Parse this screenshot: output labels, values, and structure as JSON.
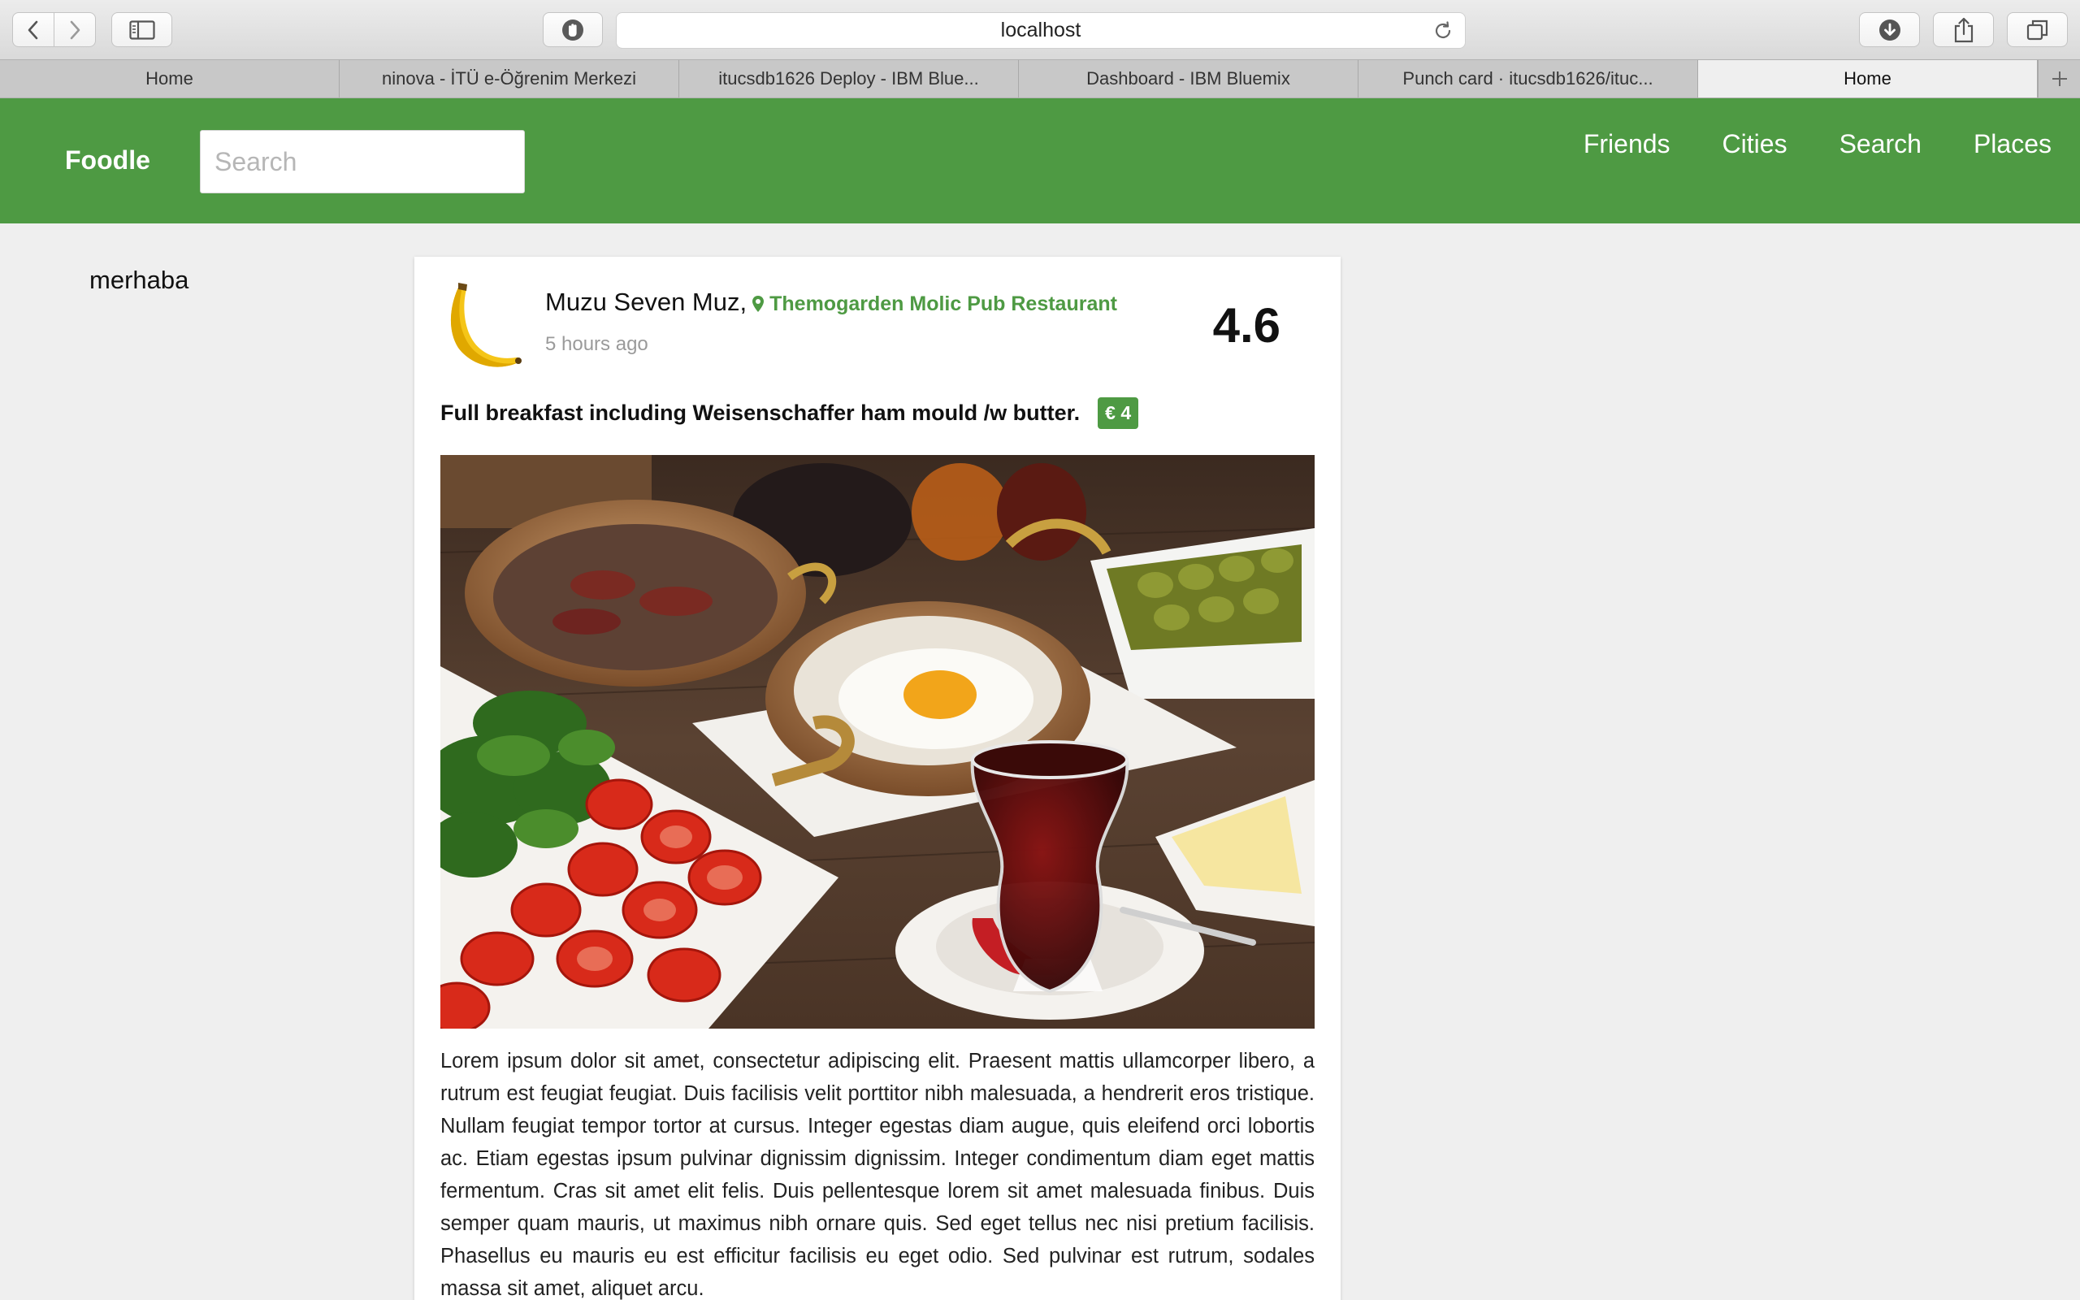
{
  "browser": {
    "url": "localhost",
    "tabs": [
      {
        "label": "Home",
        "active": false
      },
      {
        "label": "ninova - İTÜ e-Öğrenim Merkezi",
        "active": false
      },
      {
        "label": "itucsdb1626 Deploy - IBM Blue...",
        "active": false
      },
      {
        "label": "Dashboard - IBM Bluemix",
        "active": false
      },
      {
        "label": "Punch card · itucsdb1626/ituc...",
        "active": false
      },
      {
        "label": "Home",
        "active": true
      }
    ],
    "icons": [
      "back-icon",
      "forward-icon",
      "sidebar-icon",
      "privacy-icon",
      "reload-icon",
      "download-icon",
      "share-icon",
      "tabs-overview-icon",
      "new-tab-icon"
    ]
  },
  "navbar": {
    "brand": "Foodle",
    "search_placeholder": "Search",
    "links": [
      "Friends",
      "Cities",
      "Search",
      "Places"
    ],
    "color": "#4e9a43"
  },
  "sidebar": {
    "text": "merhaba"
  },
  "post": {
    "author": "Muzu Seven Muz",
    "comma": ",",
    "place": "Themogarden Molic Pub Restaurant",
    "time": "5 hours ago",
    "rating": "4.6",
    "caption": "Full breakfast including Weisenschaffer ham mould /w butter.",
    "price": "€ 4",
    "avatar_icon": "banana-icon",
    "photo_alt": "photo of Turkish breakfast",
    "description": "Lorem ipsum dolor sit amet, consectetur adipiscing elit. Praesent mattis ullamcorper libero, a rutrum est feugiat feugiat. Duis facilisis velit porttitor nibh malesuada, a hendrerit eros tristique. Nullam feugiat tempor tortor at cursus. Integer egestas diam augue, quis eleifend orci lobortis ac. Etiam egestas ipsum pulvinar dignissim dignissim. Integer condimentum diam eget mattis fermentum. Cras sit amet elit felis. Duis pellentesque lorem sit amet malesuada finibus. Duis semper quam mauris, ut maximus nibh ornare quis. Sed eget tellus nec nisi pretium facilisis. Phasellus eu mauris eu est efficitur facilisis eu eget odio. Sed pulvinar est rutrum, sodales massa sit amet, aliquet arcu."
  }
}
